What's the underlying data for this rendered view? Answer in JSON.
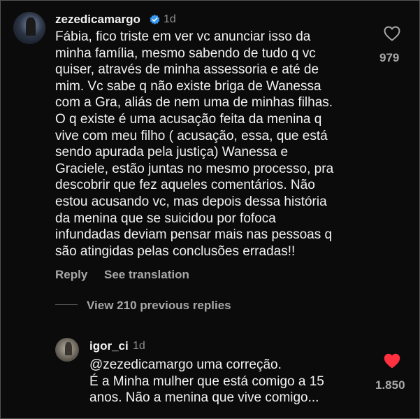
{
  "comment": {
    "username": "zezedicamargo",
    "time": "1d",
    "text": "Fábia, fico triste em ver vc anunciar isso da\nminha família, mesmo sabendo de tudo q vc\nquiser, através de minha assessoria e até de\nmim. Vc sabe q não existe briga de Wanessa\ncom a Gra, aliás de nem uma de minhas filhas.\nO q existe é uma acusação feita da menina q\nvive com meu filho ( acusação, essa, que está\nsendo apurada pela justiça) Wanessa e\nGraciele, estão juntas no mesmo processo, pra\ndescobrir que fez aqueles comentários. Não\nestou acusando vc, mas depois dessa história\nda menina que se suicidou por fofoca\ninfundadas deviam pensar mais nas pessoas q\nsão atingidas pelas conclusões erradas!!",
    "likes": "979",
    "reply_label": "Reply",
    "translate_label": "See translation",
    "view_replies_label": "View 210 previous replies",
    "liked": false
  },
  "reply": {
    "username": "igor_ci",
    "time": "1d",
    "text": "@zezedicamargo uma correção.\nÉ  a Minha mulher que está comigo a 15\nanos. Não a menina que vive comigo...",
    "likes": "1.850",
    "liked": true
  },
  "colors": {
    "background": "#0b0b0b",
    "verified_blue": "#3897f0",
    "like_red": "#ff3040",
    "muted_text": "#a8a8a8"
  },
  "icons": {
    "verified": "verified-badge-icon",
    "heart_outline": "heart-outline-icon",
    "heart_filled": "heart-filled-icon"
  }
}
